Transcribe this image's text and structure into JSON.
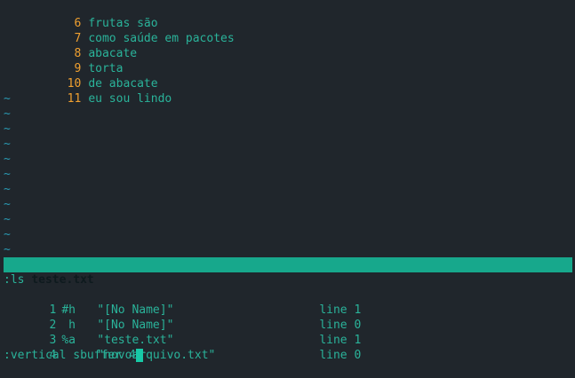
{
  "buffer_lines": [
    {
      "num": "6",
      "text": "frutas são"
    },
    {
      "num": "7",
      "text": "como saúde em pacotes"
    },
    {
      "num": "8",
      "text": "abacate"
    },
    {
      "num": "9",
      "text": "torta"
    },
    {
      "num": "10",
      "text": "de abacate"
    },
    {
      "num": "11",
      "text": "eu sou lindo"
    }
  ],
  "empty_line_marker": "~",
  "statusline": {
    "filename": "teste.txt"
  },
  "ls_command": ":ls",
  "buffer_list": [
    {
      "num": "1",
      "flags": "#h",
      "name": "\"[No Name]\"",
      "line": "line 1"
    },
    {
      "num": "2",
      "flags": " h",
      "name": "\"[No Name]\"",
      "line": "line 0"
    },
    {
      "num": "3",
      "flags": "%a",
      "name": "\"teste.txt\"",
      "line": "line 1"
    },
    {
      "num": "4",
      "flags": "",
      "name": "\"novoarquivo.txt\"",
      "line": "line 0"
    }
  ],
  "command_line": {
    "text": ":vertical sbuffer 4"
  },
  "colors": {
    "background": "#20262c",
    "text": "#2ab39a",
    "line_number": "#f0a030",
    "tilde": "#2a9ab3",
    "statusline_bg": "#17a88c"
  }
}
